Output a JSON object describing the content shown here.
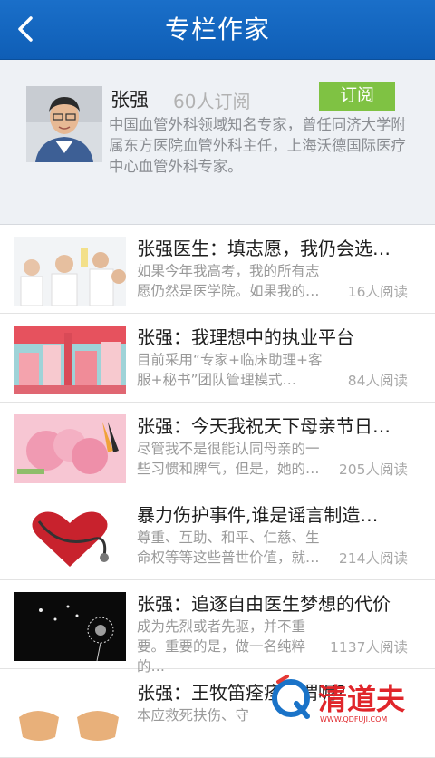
{
  "header": {
    "title": "专栏作家",
    "back_icon": "chevron-left-icon"
  },
  "author": {
    "name": "张强",
    "subscribers": "60人订阅",
    "subscribe_label": "订阅",
    "bio": "中国血管外科领域知名专家，曾任同济大学附属东方医院血管外科主任，上海沃德国际医疗中心血管外科专家。",
    "accent_color": "#7fc243"
  },
  "articles": [
    {
      "title": "张强医生：填志愿，我仍会选…",
      "summary": "如果今年我高考，我的所有志愿仍然是医学院。如果我的…",
      "reads": "16人阅读"
    },
    {
      "title": "张强：我理想中的执业平台",
      "summary": "目前采用“专家+临床助理+客服+秘书”团队管理模式…",
      "reads": "84人阅读"
    },
    {
      "title": "张强：今天我祝天下母亲节日…",
      "summary": "尽管我不是很能认同母亲的一些习惯和脾气，但是，她的…",
      "reads": "205人阅读"
    },
    {
      "title": "暴力伤护事件,谁是谣言制造…",
      "summary": "尊重、互助、和平、仁慈、生命权等等这些普世价值，就…",
      "reads": "214人阅读"
    },
    {
      "title": "张强：追逐自由医生梦想的代价",
      "summary": "成为先烈或者先驱，并不重要。重要的是，做一名纯粹的…",
      "reads": "1137人阅读"
    },
    {
      "title": "张强：王牧笛痊痊不谓呢？",
      "summary": "本应救死扶伤、守",
      "reads": ""
    }
  ],
  "watermark": {
    "text": "清道夫",
    "url": "WWW.QDFUJI.COM"
  },
  "colors": {
    "header": "#1266c0",
    "accent": "#7fc243"
  }
}
